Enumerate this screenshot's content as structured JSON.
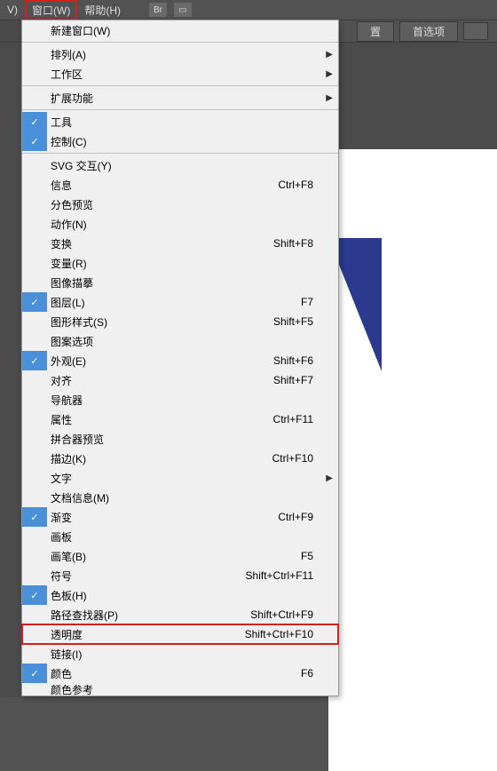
{
  "menubar": {
    "view_tail": "V)",
    "window": "窗口(W)",
    "help": "帮助(H)",
    "br": "Br"
  },
  "toolbar": {
    "settings_tail": "置",
    "prefs": "首选项"
  },
  "menu": {
    "new_window": "新建窗口(W)",
    "arrange": "排列(A)",
    "workspace": "工作区",
    "extensions": "扩展功能",
    "tools": "工具",
    "control": "控制(C)",
    "svg": "SVG 交互(Y)",
    "info": "信息",
    "info_sc": "Ctrl+F8",
    "sep_preview": "分色预览",
    "actions": "动作(N)",
    "transform": "变换",
    "transform_sc": "Shift+F8",
    "variables": "变量(R)",
    "image_trace": "图像描摹",
    "layers": "图层(L)",
    "layers_sc": "F7",
    "graphic_styles": "图形样式(S)",
    "graphic_styles_sc": "Shift+F5",
    "pattern_options": "图案选项",
    "appearance": "外观(E)",
    "appearance_sc": "Shift+F6",
    "align": "对齐",
    "align_sc": "Shift+F7",
    "navigator": "导航器",
    "attributes": "属性",
    "attributes_sc": "Ctrl+F11",
    "flattener": "拼合器预览",
    "stroke": "描边(K)",
    "stroke_sc": "Ctrl+F10",
    "type": "文字",
    "doc_info": "文档信息(M)",
    "gradient": "渐变",
    "gradient_sc": "Ctrl+F9",
    "artboards": "画板",
    "brushes": "画笔(B)",
    "brushes_sc": "F5",
    "symbols": "符号",
    "symbols_sc": "Shift+Ctrl+F11",
    "swatches": "色板(H)",
    "pathfinder": "路径查找器(P)",
    "pathfinder_sc": "Shift+Ctrl+F9",
    "transparency": "透明度",
    "transparency_sc": "Shift+Ctrl+F10",
    "links": "链接(I)",
    "color": "颜色",
    "color_sc": "F6",
    "last": "颜色参考"
  }
}
